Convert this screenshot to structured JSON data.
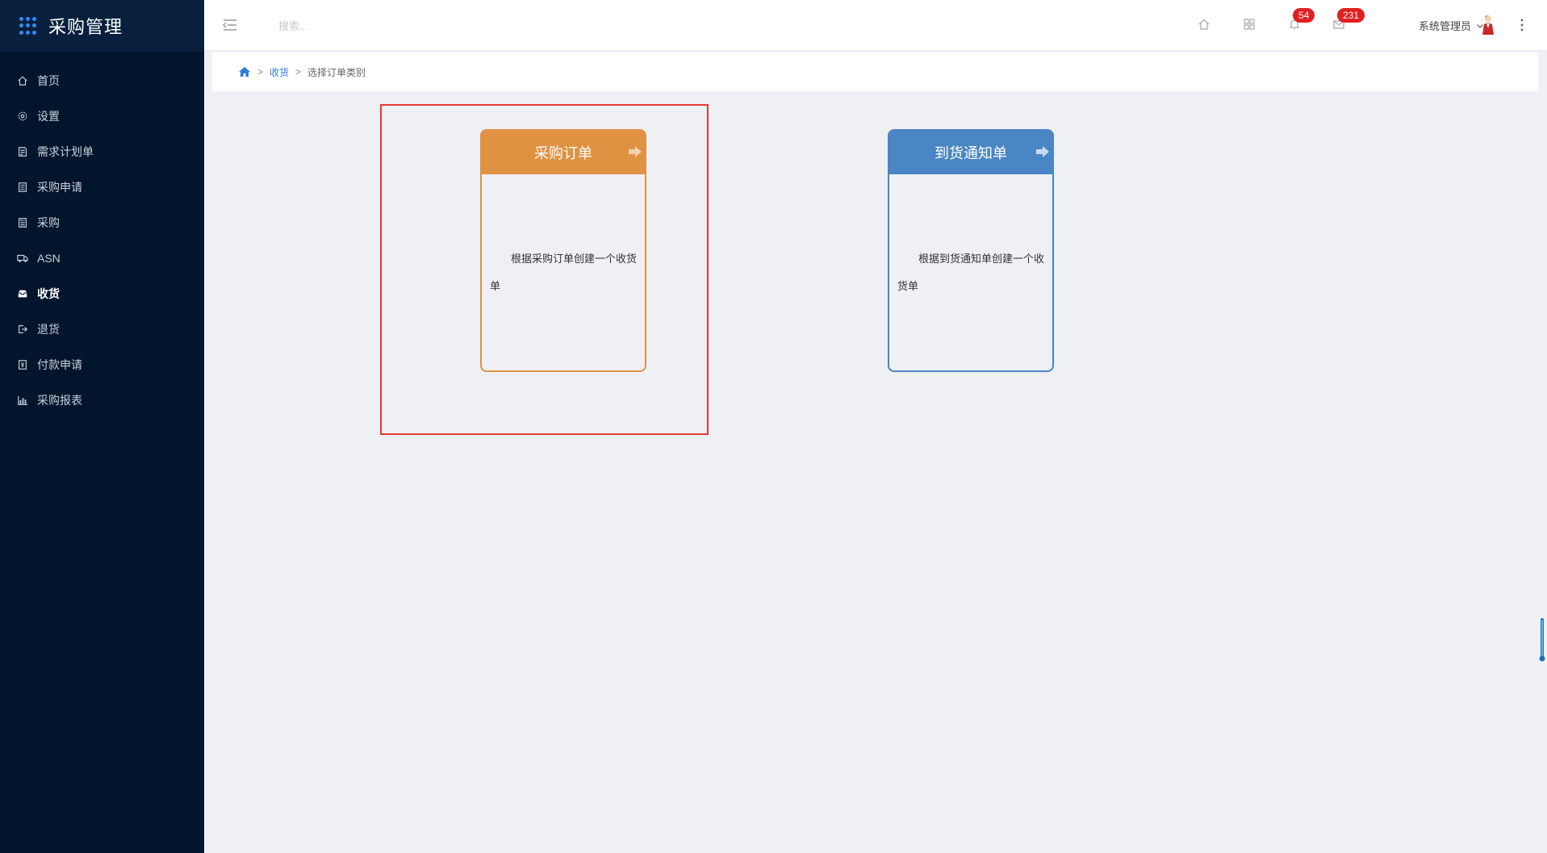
{
  "app": {
    "title": "采购管理"
  },
  "sidebar": {
    "items": [
      {
        "label": "首页",
        "icon": "home-icon"
      },
      {
        "label": "设置",
        "icon": "gear-icon"
      },
      {
        "label": "需求计划单",
        "icon": "document-icon"
      },
      {
        "label": "采购申请",
        "icon": "clipboard-icon"
      },
      {
        "label": "采购",
        "icon": "list-icon"
      },
      {
        "label": "ASN",
        "icon": "truck-icon"
      },
      {
        "label": "收货",
        "icon": "inbox-icon"
      },
      {
        "label": "退货",
        "icon": "exit-icon"
      },
      {
        "label": "付款申请",
        "icon": "payment-icon"
      },
      {
        "label": "采购报表",
        "icon": "bar-chart-icon"
      }
    ],
    "active": "收货"
  },
  "header": {
    "search_placeholder": "搜索...",
    "notifications_count": "54",
    "messages_count": "231",
    "user_name": "系统管理员"
  },
  "breadcrumb": {
    "link": "收货",
    "current": "选择订单类别"
  },
  "cards": [
    {
      "title": "采购订单",
      "description": "根据采购订单创建一个收货单",
      "color": "#e09243"
    },
    {
      "title": "到货通知单",
      "description": "根据到货通知单创建一个收货单",
      "color": "#4a86c4"
    }
  ],
  "colors": {
    "sidebar_bg": "#03152d",
    "accent": "#2f8cf0",
    "highlight": "#e53935"
  }
}
